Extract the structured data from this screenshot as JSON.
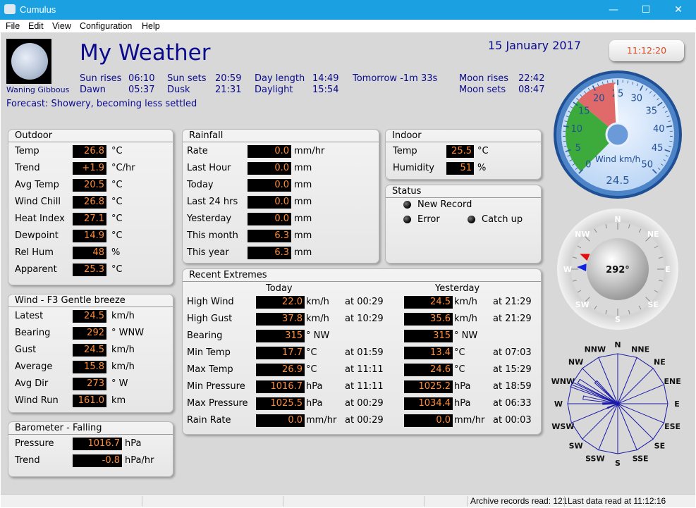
{
  "window": {
    "title": "Cumulus",
    "minimize": "—",
    "maximize": "☐",
    "close": "✕"
  },
  "menu": [
    "File",
    "Edit",
    "View",
    "Configuration",
    "Help"
  ],
  "header": {
    "title": "My Weather",
    "date": "15 January 2017",
    "time": "11:12:20",
    "moon_phase": "Waning Gibbous",
    "sun_rises_label": "Sun rises",
    "sun_rises": "06:10",
    "sun_sets_label": "Sun sets",
    "sun_sets": "20:59",
    "day_length_label": "Day length",
    "day_length": "14:49",
    "tomorrow": "Tomorrow -1m 33s",
    "moon_rises_label": "Moon rises",
    "moon_rises": "22:42",
    "dawn_label": "Dawn",
    "dawn": "05:37",
    "dusk_label": "Dusk",
    "dusk": "21:31",
    "daylight_label": "Daylight",
    "daylight": "15:54",
    "moon_sets_label": "Moon sets",
    "moon_sets": "08:47",
    "forecast": "Forecast: Showery, becoming less settled"
  },
  "outdoor": {
    "title": "Outdoor",
    "rows": [
      {
        "label": "Temp",
        "value": "26.8",
        "unit": "°C"
      },
      {
        "label": "Trend",
        "value": "+1.9",
        "unit": "°C/hr"
      },
      {
        "label": "Avg Temp",
        "value": "20.5",
        "unit": "°C"
      },
      {
        "label": "Wind Chill",
        "value": "26.8",
        "unit": "°C"
      },
      {
        "label": "Heat Index",
        "value": "27.1",
        "unit": "°C"
      },
      {
        "label": "Dewpoint",
        "value": "14.9",
        "unit": "°C"
      },
      {
        "label": "Rel Hum",
        "value": "48",
        "unit": "%"
      },
      {
        "label": "Apparent",
        "value": "25.3",
        "unit": "°C"
      }
    ]
  },
  "wind": {
    "title": "Wind - F3 Gentle breeze",
    "rows": [
      {
        "label": "Latest",
        "value": "24.5",
        "unit": "km/h"
      },
      {
        "label": "Bearing",
        "value": "292",
        "unit": "° WNW"
      },
      {
        "label": "Gust",
        "value": "24.5",
        "unit": "km/h"
      },
      {
        "label": "Average",
        "value": "15.8",
        "unit": "km/h"
      },
      {
        "label": "Avg Dir",
        "value": "273",
        "unit": "° W"
      },
      {
        "label": "Wind Run",
        "value": "161.0",
        "unit": "km"
      }
    ]
  },
  "barometer": {
    "title": "Barometer - Falling",
    "rows": [
      {
        "label": "Pressure",
        "value": "1016.7",
        "unit": "hPa"
      },
      {
        "label": "Trend",
        "value": "-0.8",
        "unit": "hPa/hr"
      }
    ]
  },
  "rainfall": {
    "title": "Rainfall",
    "rows": [
      {
        "label": "Rate",
        "value": "0.0",
        "unit": "mm/hr"
      },
      {
        "label": "Last Hour",
        "value": "0.0",
        "unit": "mm"
      },
      {
        "label": "Today",
        "value": "0.0",
        "unit": "mm"
      },
      {
        "label": "Last 24 hrs",
        "value": "0.0",
        "unit": "mm"
      },
      {
        "label": "Yesterday",
        "value": "0.0",
        "unit": "mm"
      },
      {
        "label": "This month",
        "value": "6.3",
        "unit": "mm"
      },
      {
        "label": "This year",
        "value": "6.3",
        "unit": "mm"
      }
    ]
  },
  "indoor": {
    "title": "Indoor",
    "rows": [
      {
        "label": "Temp",
        "value": "25.5",
        "unit": "°C"
      },
      {
        "label": "Humidity",
        "value": "51",
        "unit": "%"
      }
    ]
  },
  "status": {
    "title": "Status",
    "new_record": "New Record",
    "error": "Error",
    "catch_up": "Catch up"
  },
  "extremes": {
    "title": "Recent Extremes",
    "today_header": "Today",
    "yesterday_header": "Yesterday",
    "rows": [
      {
        "label": "High Wind",
        "today": "22.0",
        "today_unit": "km/h",
        "today_time": "at 00:29",
        "yest": "24.5",
        "yest_unit": "km/h",
        "yest_time": "at 21:29"
      },
      {
        "label": "High Gust",
        "today": "37.8",
        "today_unit": "km/h",
        "today_time": "at 10:29",
        "yest": "35.6",
        "yest_unit": "km/h",
        "yest_time": "at 21:29"
      },
      {
        "label": "Bearing",
        "today": "315",
        "today_unit": "°  NW",
        "today_time": "",
        "yest": "315",
        "yest_unit": "°  NW",
        "yest_time": ""
      },
      {
        "label": "Min Temp",
        "today": "17.7",
        "today_unit": "°C",
        "today_time": "at 01:59",
        "yest": "13.4",
        "yest_unit": "°C",
        "yest_time": "at 07:03"
      },
      {
        "label": "Max Temp",
        "today": "26.9",
        "today_unit": "°C",
        "today_time": "at 11:11",
        "yest": "24.6",
        "yest_unit": "°C",
        "yest_time": "at 15:29"
      },
      {
        "label": "Min Pressure",
        "today": "1016.7",
        "today_unit": "hPa",
        "today_time": "at 11:11",
        "yest": "1025.2",
        "yest_unit": "hPa",
        "yest_time": "at 18:59"
      },
      {
        "label": "Max Pressure",
        "today": "1025.5",
        "today_unit": "hPa",
        "today_time": "at 00:29",
        "yest": "1034.4",
        "yest_unit": "hPa",
        "yest_time": "at 06:33"
      },
      {
        "label": "Rain Rate",
        "today": "0.0",
        "today_unit": "mm/hr",
        "today_time": "at 00:29",
        "yest": "0.0",
        "yest_unit": "mm/hr",
        "yest_time": "at 00:03"
      }
    ]
  },
  "wind_gauge": {
    "label": "Wind km/h",
    "readout": "24.5",
    "ticks": [
      "0",
      "5",
      "10",
      "15",
      "20",
      "25",
      "30",
      "35",
      "40",
      "45",
      "50"
    ],
    "speed": 24.5,
    "colors": {
      "green": "#3cab3c",
      "red": "#e06a6a",
      "face": "#bcd6f5",
      "rim": "#4d84c8"
    }
  },
  "compass": {
    "readout": "292°",
    "bearing": 292,
    "points": [
      "N",
      "NE",
      "E",
      "SE",
      "S",
      "SW",
      "W",
      "NW"
    ]
  },
  "wind_rose": {
    "points": [
      "N",
      "NNE",
      "NE",
      "ENE",
      "E",
      "ESE",
      "SE",
      "SSE",
      "S",
      "SSW",
      "SW",
      "WSW",
      "W",
      "WNW",
      "NW",
      "NNW"
    ],
    "color": "#1a1aa8"
  },
  "statusbar": {
    "archive": "Archive records read: 121",
    "last_data": "Last data read at 11:12:16"
  }
}
